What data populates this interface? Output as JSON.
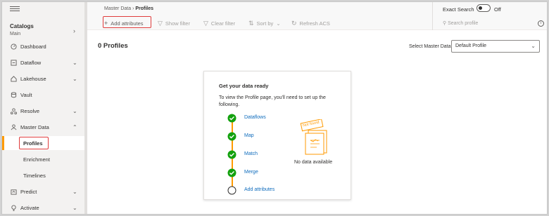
{
  "sidebar": {
    "catalogs_title": "Catalogs",
    "catalogs_sub": "Main",
    "items": [
      {
        "label": "Dashboard",
        "icon": "dashboard-icon",
        "chevron": false
      },
      {
        "label": "Dataflow",
        "icon": "dataflow-icon",
        "chevron": true
      },
      {
        "label": "Lakehouse",
        "icon": "lakehouse-icon",
        "chevron": true
      },
      {
        "label": "Vault",
        "icon": "vault-icon",
        "chevron": false
      },
      {
        "label": "Resolve",
        "icon": "resolve-icon",
        "chevron": true
      },
      {
        "label": "Master Data",
        "icon": "master-data-icon",
        "chevron": true
      }
    ],
    "subitems": [
      "Profiles",
      "Enrichment",
      "Timelines"
    ],
    "items_after": [
      {
        "label": "Predict",
        "icon": "predict-icon",
        "chevron": true
      },
      {
        "label": "Activate",
        "icon": "activate-icon",
        "chevron": true
      }
    ]
  },
  "breadcrumb": {
    "parent": "Master Data",
    "current": "Profiles"
  },
  "toolbar": {
    "add_attributes": "Add attributes",
    "show_filter": "Show filter",
    "clear_filter": "Clear filter",
    "sort_by": "Sort by",
    "refresh": "Refresh ACS"
  },
  "exact_search": {
    "label": "Exact Search",
    "state": "Off"
  },
  "search": {
    "placeholder": "Search profile"
  },
  "main": {
    "title": "0 Profiles",
    "select_label": "Select Master Data",
    "select_value": "Default Profile"
  },
  "card": {
    "title": "Get your data ready",
    "description": "To view the Profile page, you'll need to set up the following.",
    "steps": [
      {
        "label": "Dataflows",
        "done": true
      },
      {
        "label": "Map",
        "done": true
      },
      {
        "label": "Match",
        "done": true
      },
      {
        "label": "Merge",
        "done": true
      },
      {
        "label": "Add attributes",
        "done": false
      }
    ],
    "not_found_tag": "Not found",
    "no_data": "No data available"
  },
  "colors": {
    "accent": "#ff9a00",
    "success": "#13a10e",
    "link": "#0f6cbd",
    "highlight": "#e03c3c"
  }
}
